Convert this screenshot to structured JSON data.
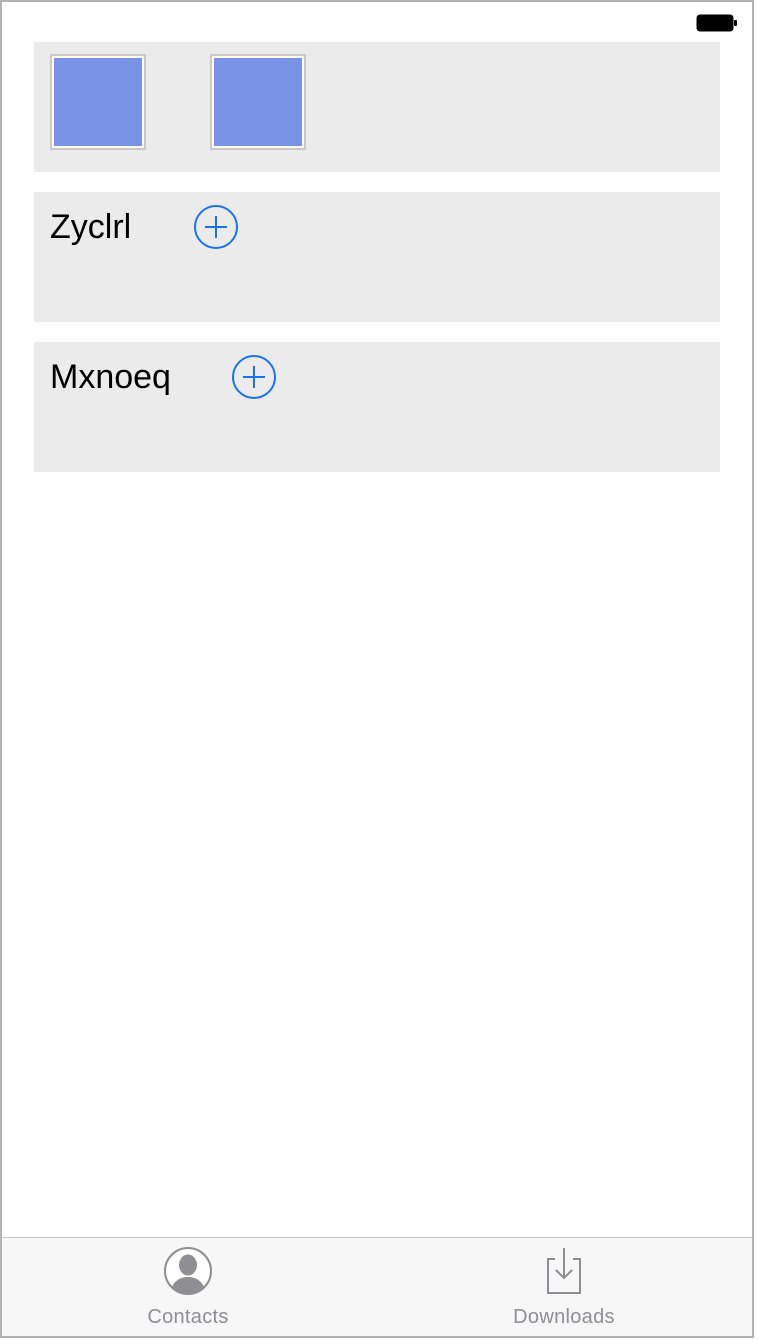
{
  "status_bar": {
    "battery_icon": "battery-full-icon"
  },
  "tiles": [
    {
      "color": "#7a92e6"
    },
    {
      "color": "#7a92e6"
    }
  ],
  "sections": [
    {
      "label": "Zyclrl",
      "add_icon": "plus-circle-icon"
    },
    {
      "label": "Mxnoeq",
      "add_icon": "plus-circle-icon"
    }
  ],
  "tabbar": {
    "items": [
      {
        "label": "Contacts",
        "icon": "person-circle-icon"
      },
      {
        "label": "Downloads",
        "icon": "download-tray-icon"
      }
    ]
  },
  "colors": {
    "accent": "#1a73e8",
    "panel_bg": "#ebebeb",
    "tile": "#7a92e6",
    "tab_inactive": "#8e8e93"
  }
}
